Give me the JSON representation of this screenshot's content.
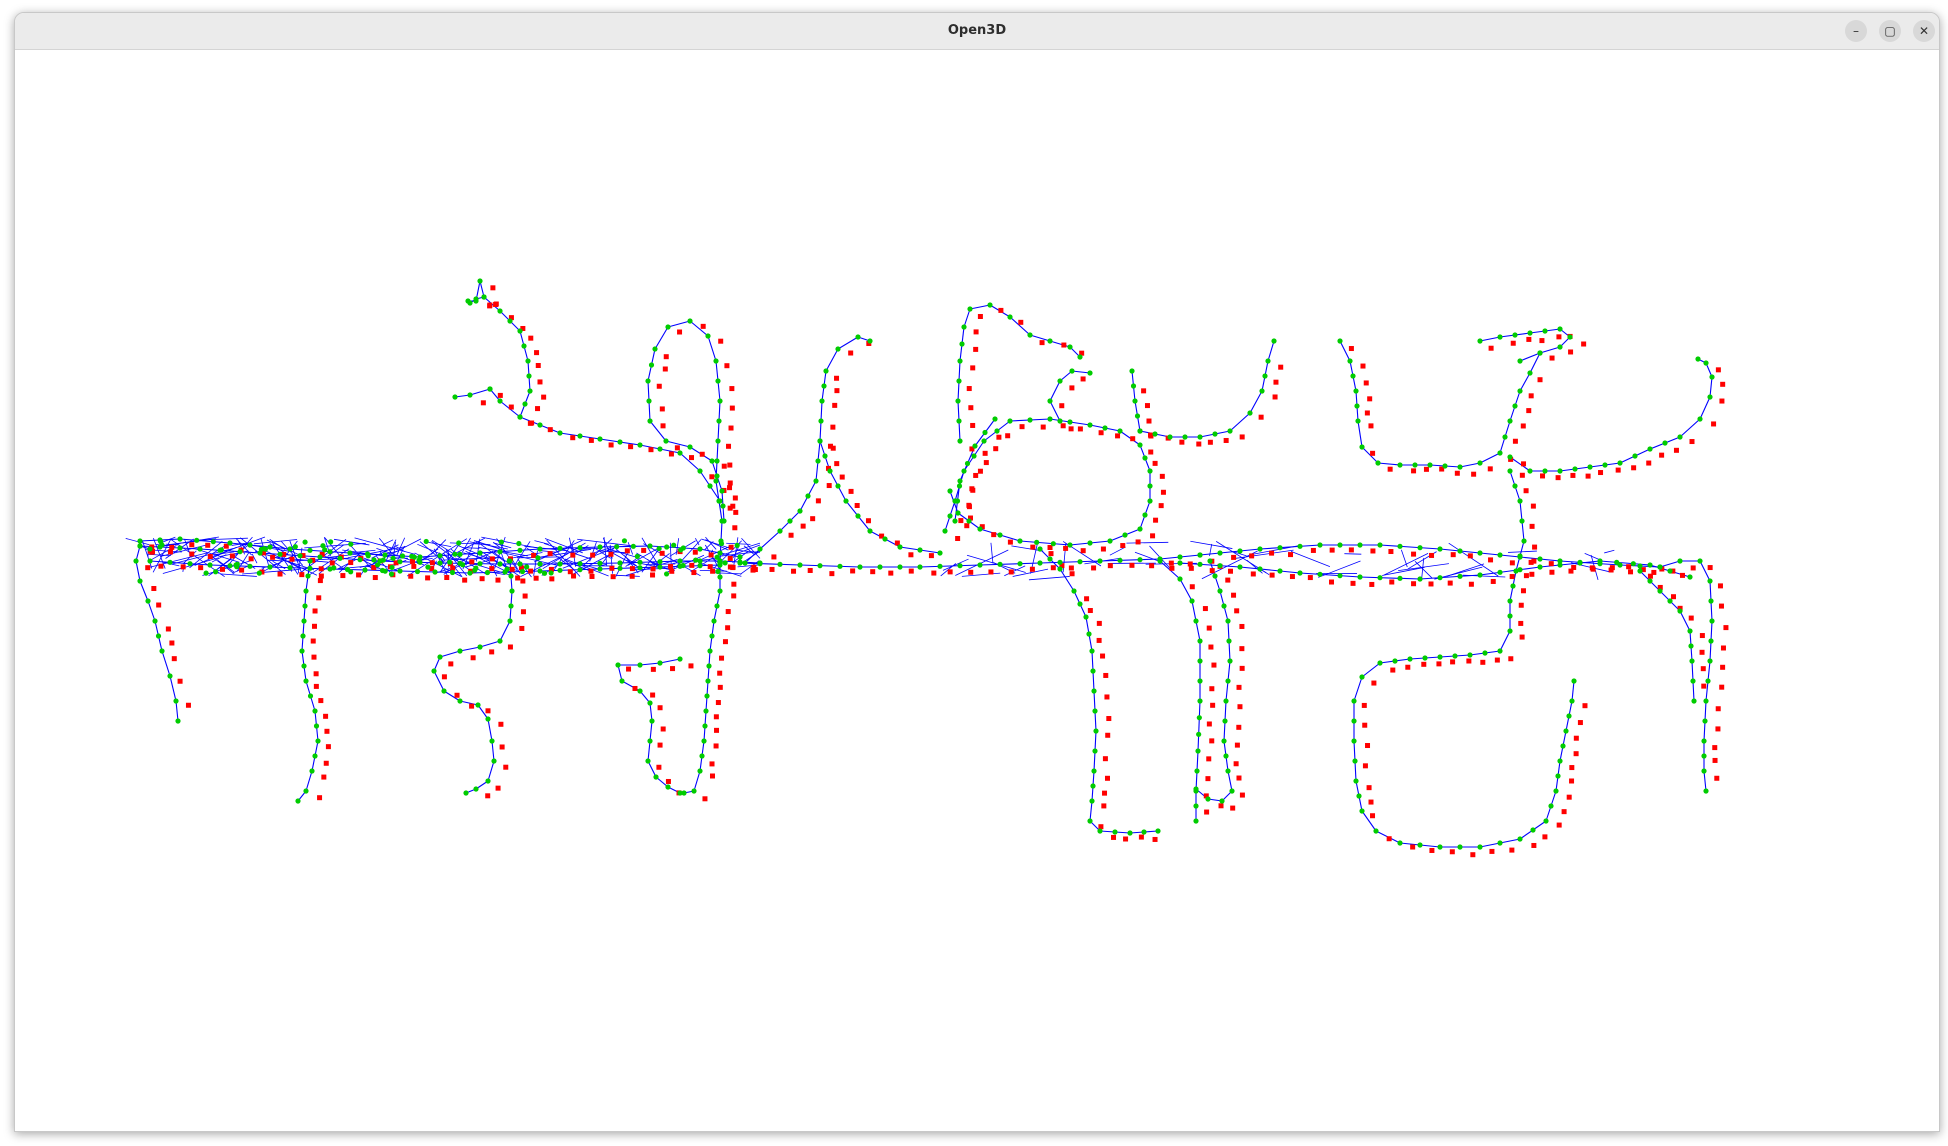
{
  "window": {
    "title": "Open3D",
    "controls": {
      "minimize_icon": "minimize-icon",
      "maximize_icon": "maximize-icon",
      "close_icon": "close-icon",
      "minimize_glyph": "–",
      "maximize_glyph": "▢",
      "close_glyph": "✕"
    }
  },
  "scene": {
    "background": "#ffffff",
    "colors": {
      "reference_points": "#ff0000",
      "graph_nodes": "#00cc00",
      "graph_edges": "#0000ff"
    }
  }
}
